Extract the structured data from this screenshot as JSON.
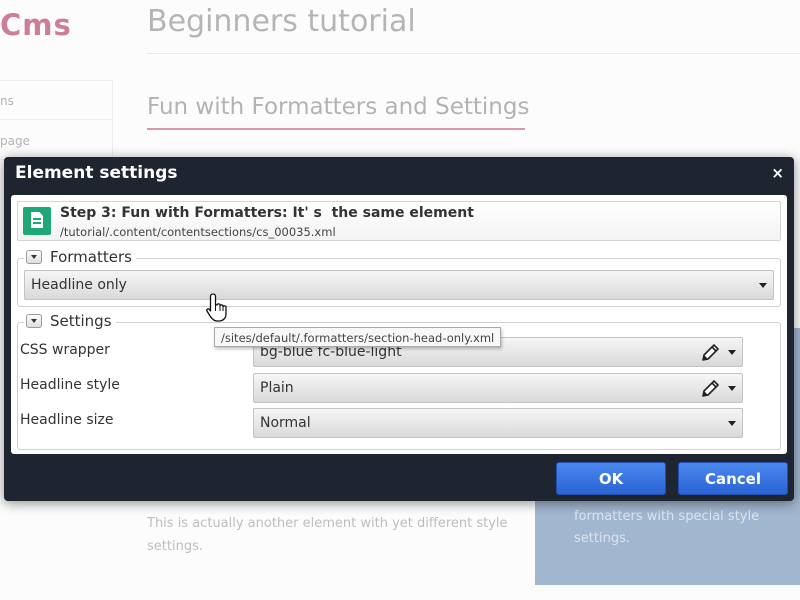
{
  "page": {
    "logo": "Cms",
    "title": "Beginners tutorial",
    "section_title": "Fun with Formatters and Settings",
    "nav_items": [
      "ns",
      "page"
    ],
    "bottom_text": "This is actually another element with yet different style settings.",
    "blue_box_text": "formatters with special style settings."
  },
  "dialog": {
    "title": "Element settings",
    "close": "×",
    "element": {
      "title": "Step 3: Fun with Formatters: It' s  the same element",
      "path": "/tutorial/.content/contentsections/cs_00035.xml",
      "icon": "document-icon"
    },
    "formatters": {
      "legend": "Formatters",
      "selected": "Headline only",
      "tooltip": "/sites/default/.formatters/section-head-only.xml"
    },
    "settings": {
      "legend": "Settings",
      "fields": [
        {
          "label": "CSS wrapper",
          "value": "bg-blue fc-blue-light",
          "editable": true
        },
        {
          "label": "Headline style",
          "value": "Plain",
          "editable": true
        },
        {
          "label": "Headline size",
          "value": "Normal",
          "editable": false
        }
      ]
    },
    "buttons": {
      "ok": "OK",
      "cancel": "Cancel"
    }
  },
  "colors": {
    "dialog_bg": "#1e2531",
    "button_blue": "#3a74e0",
    "logo": "#b33a5e",
    "section_underline": "#c4607e",
    "doc_icon": "#1fa876",
    "blue_box": "#6f8fb6"
  }
}
